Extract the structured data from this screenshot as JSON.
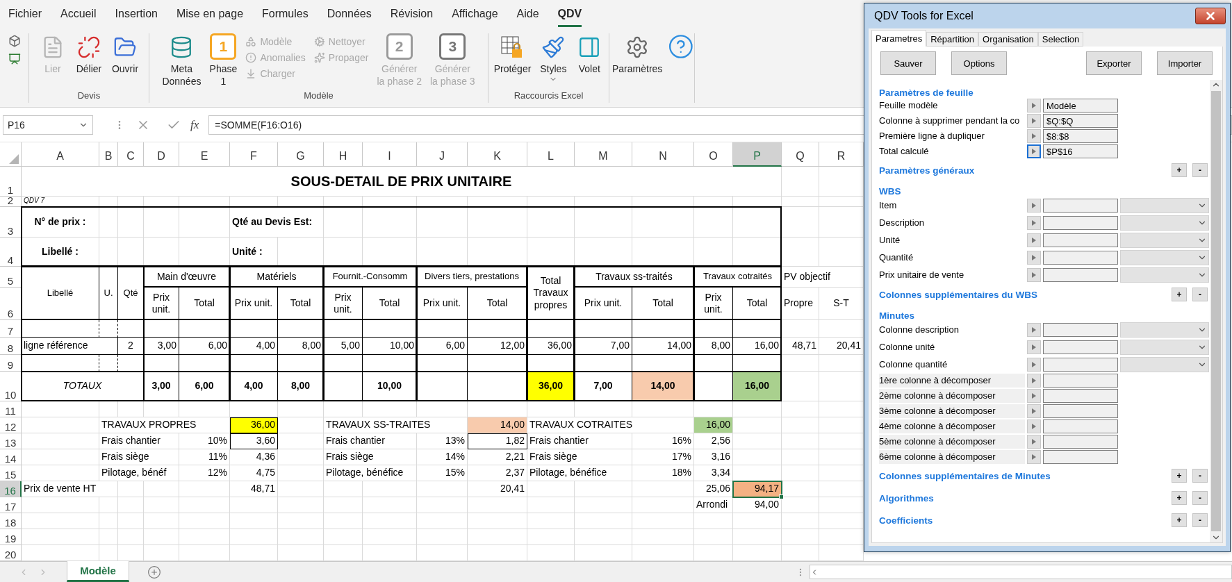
{
  "ribbon": {
    "tabs": [
      {
        "label": "Fichier",
        "selected": false
      },
      {
        "label": "Accueil",
        "selected": false
      },
      {
        "label": "Insertion",
        "selected": false
      },
      {
        "label": "Mise en page",
        "selected": false
      },
      {
        "label": "Formules",
        "selected": false
      },
      {
        "label": "Données",
        "selected": false
      },
      {
        "label": "Révision",
        "selected": false
      },
      {
        "label": "Affichage",
        "selected": false
      },
      {
        "label": "Aide",
        "selected": false
      },
      {
        "label": "QDV",
        "selected": true
      }
    ],
    "groups": [
      {
        "items": [
          {
            "kind": "mini"
          },
          {
            "kind": "mini"
          }
        ]
      },
      {
        "label": "Devis",
        "items": [
          {
            "kind": "large",
            "lines": [
              "Lier"
            ],
            "disabled": true
          },
          {
            "kind": "large",
            "lines": [
              "Délier"
            ],
            "disabled": false
          },
          {
            "kind": "large",
            "lines": [
              "Ouvrir"
            ],
            "disabled": false
          }
        ]
      },
      {
        "label": "Modèle",
        "items": [
          {
            "kind": "large",
            "lines": [
              "Meta",
              "Données"
            ],
            "disabled": false
          },
          {
            "kind": "badge",
            "badge": "1",
            "lines": [
              "Phase",
              "1"
            ],
            "disabled": false
          },
          {
            "kind": "stack",
            "entries": [
              {
                "label": "Modèle",
                "disabled": true
              },
              {
                "label": "Anomalies",
                "disabled": true
              },
              {
                "label": "Charger",
                "disabled": true
              }
            ]
          },
          {
            "kind": "stack",
            "entries": [
              {
                "label": "Nettoyer",
                "disabled": true
              },
              {
                "label": "Propager",
                "disabled": true
              }
            ]
          },
          {
            "kind": "badge",
            "badge": "2",
            "lines": [
              "Générer",
              "la phase 2"
            ],
            "disabled": true
          },
          {
            "kind": "badge",
            "badge": "3",
            "lines": [
              "Générer",
              "la phase 3"
            ],
            "disabled": true
          }
        ]
      },
      {
        "label": "Raccourcis Excel",
        "items": [
          {
            "kind": "large",
            "lines": [
              "Protéger"
            ],
            "disabled": false
          },
          {
            "kind": "menu",
            "lines": [
              "Styles"
            ],
            "disabled": false
          },
          {
            "kind": "large",
            "lines": [
              "Volet"
            ],
            "disabled": false
          }
        ]
      },
      {
        "items": [
          {
            "kind": "large",
            "lines": [
              "Paramètres"
            ],
            "disabled": false
          },
          {
            "kind": "mini"
          }
        ]
      }
    ]
  },
  "sheet": {
    "name_box": "P16",
    "function_label": "fx",
    "formula": "=SOMME(F16:O16)",
    "columns": [
      {
        "label": "A",
        "selected": false
      },
      {
        "label": "B",
        "selected": false
      },
      {
        "label": "C",
        "selected": false
      },
      {
        "label": "D",
        "selected": false
      },
      {
        "label": "E",
        "selected": false
      },
      {
        "label": "F",
        "selected": false
      },
      {
        "label": "G",
        "selected": false
      },
      {
        "label": "H",
        "selected": false
      },
      {
        "label": "I",
        "selected": false
      },
      {
        "label": "J",
        "selected": false
      },
      {
        "label": "K",
        "selected": false
      },
      {
        "label": "L",
        "selected": false
      },
      {
        "label": "M",
        "selected": false
      },
      {
        "label": "N",
        "selected": false
      },
      {
        "label": "O",
        "selected": false
      },
      {
        "label": "P",
        "selected": true
      },
      {
        "label": "Q",
        "selected": false
      },
      {
        "label": "R",
        "selected": false
      }
    ],
    "rows": [
      {
        "number": "1",
        "selected": false,
        "cells": [
          {
            "text": "SOUS-DETAIL DE PRIX UNITAIRE"
          }
        ]
      },
      {
        "number": "2",
        "selected": false,
        "cells": [
          {
            "text": "QDV 7"
          }
        ]
      },
      {
        "number": "3",
        "selected": false,
        "cells": [
          {
            "text": "N° de prix :"
          },
          {
            "text": "Qté au Devis Est:"
          }
        ]
      },
      {
        "number": "4",
        "selected": false,
        "cells": [
          {
            "text": "Libellé :"
          },
          {
            "text": "Unité :"
          }
        ]
      },
      {
        "number": "5",
        "selected": false,
        "cells": [
          {
            "text": "Libellé"
          },
          {
            "text": "U."
          },
          {
            "text": "Qté"
          },
          {
            "text": "Main d'œuvre"
          },
          {
            "text": "Matériels"
          },
          {
            "text": "Fournit.-Consomm"
          },
          {
            "text": "Divers tiers, prestations"
          },
          {
            "text": "Total Travaux propres"
          },
          {
            "text": "Travaux ss-traités"
          },
          {
            "text": "Travaux cotraités"
          },
          {
            "text": "PV objectif"
          }
        ]
      },
      {
        "number": "6",
        "selected": false,
        "cells": [
          {
            "text": "Prix unit."
          },
          {
            "text": "Total"
          },
          {
            "text": "Prix unit."
          },
          {
            "text": "Total"
          },
          {
            "text": "Prix unit."
          },
          {
            "text": "Total"
          },
          {
            "text": "Prix unit."
          },
          {
            "text": "Total"
          },
          {
            "text": "Prix unit."
          },
          {
            "text": "Total"
          },
          {
            "text": "Prix unit."
          },
          {
            "text": "Total"
          },
          {
            "text": "Propre"
          },
          {
            "text": "S-T"
          }
        ]
      },
      {
        "number": "7",
        "selected": false
      },
      {
        "number": "8",
        "selected": false,
        "cells": [
          {
            "text": "ligne référence"
          },
          {
            "text": "2"
          },
          {
            "text": "3,00"
          },
          {
            "text": "6,00"
          },
          {
            "text": "4,00"
          },
          {
            "text": "8,00"
          },
          {
            "text": "5,00"
          },
          {
            "text": "10,00"
          },
          {
            "text": "6,00"
          },
          {
            "text": "12,00"
          },
          {
            "text": "36,00"
          },
          {
            "text": "7,00"
          },
          {
            "text": "14,00"
          },
          {
            "text": "8,00"
          },
          {
            "text": "16,00"
          },
          {
            "text": "48,71"
          },
          {
            "text": "20,41"
          }
        ]
      },
      {
        "number": "9",
        "selected": false
      },
      {
        "number": "10",
        "selected": false,
        "cells": [
          {
            "text": "TOTAUX"
          },
          {
            "text": "3,00"
          },
          {
            "text": "6,00"
          },
          {
            "text": "4,00"
          },
          {
            "text": "8,00"
          },
          {
            "text": "10,00"
          },
          {
            "text": "36,00",
            "color": "#ffff00"
          },
          {
            "text": "7,00"
          },
          {
            "text": "14,00",
            "color": "#f8cbad"
          },
          {
            "text": "16,00",
            "color": "#a9d08e"
          }
        ]
      },
      {
        "number": "11",
        "selected": false
      },
      {
        "number": "12",
        "selected": false,
        "cells": [
          {
            "text": "TRAVAUX PROPRES"
          },
          {
            "text": "36,00",
            "color": "#ffff00"
          },
          {
            "text": "TRAVAUX SS-TRAITES"
          },
          {
            "text": "14,00",
            "color": "#f8cbad"
          },
          {
            "text": "TRAVAUX COTRAITES"
          },
          {
            "text": "16,00",
            "color": "#a9d08e"
          }
        ]
      },
      {
        "number": "13",
        "selected": false,
        "cells": [
          {
            "text": "Frais chantier"
          },
          {
            "text": "10%"
          },
          {
            "text": "3,60"
          },
          {
            "text": "Frais chantier"
          },
          {
            "text": "13%"
          },
          {
            "text": "1,82"
          },
          {
            "text": "Frais chantier"
          },
          {
            "text": "16%"
          },
          {
            "text": "2,56"
          }
        ]
      },
      {
        "number": "14",
        "selected": false,
        "cells": [
          {
            "text": "Frais siège"
          },
          {
            "text": "11%"
          },
          {
            "text": "4,36"
          },
          {
            "text": "Frais siège"
          },
          {
            "text": "14%"
          },
          {
            "text": "2,21"
          },
          {
            "text": "Frais siège"
          },
          {
            "text": "17%"
          },
          {
            "text": "3,16"
          }
        ]
      },
      {
        "number": "15",
        "selected": false,
        "cells": [
          {
            "text": "Pilotage, bénéf"
          },
          {
            "text": "12%"
          },
          {
            "text": "4,75"
          },
          {
            "text": "Pilotage, bénéfice"
          },
          {
            "text": "15%"
          },
          {
            "text": "2,37"
          },
          {
            "text": "Pilotage, bénéfice"
          },
          {
            "text": "18%"
          },
          {
            "text": "3,34"
          }
        ]
      },
      {
        "number": "16",
        "selected": true,
        "cells": [
          {
            "text": "Prix de vente HT"
          },
          {
            "text": "48,71"
          },
          {
            "text": "20,41"
          },
          {
            "text": "25,06"
          },
          {
            "text": "94,17",
            "color": "#f4b183"
          }
        ]
      },
      {
        "number": "17",
        "selected": false,
        "cells": [
          {
            "text": "Arrondi"
          },
          {
            "text": "94,00"
          }
        ]
      },
      {
        "number": "18",
        "selected": false
      },
      {
        "number": "19",
        "selected": false
      },
      {
        "number": "20",
        "selected": false
      }
    ]
  },
  "sheet_tabs": [
    {
      "label": "Modèle",
      "selected": true
    }
  ],
  "panel": {
    "title": "QDV Tools for Excel",
    "tabs": [
      {
        "label": "Parametres",
        "selected": true
      },
      {
        "label": "Répartition",
        "selected": false
      },
      {
        "label": "Organisation",
        "selected": false
      },
      {
        "label": "Selection",
        "selected": false
      }
    ],
    "buttons": [
      "Sauver",
      "Options",
      "Exporter",
      "Importer"
    ],
    "sections": [
      {
        "title": "Paramètres de feuille",
        "rows": [
          {
            "kind": "field",
            "label": "Feuille modèle",
            "value": "Modèle",
            "focused": false
          },
          {
            "kind": "field",
            "label": "Colonne à supprimer pendant la co",
            "value": "$Q:$Q",
            "focused": false
          },
          {
            "kind": "field",
            "label": "Première ligne à dupliquer",
            "value": "$8:$8",
            "focused": false
          },
          {
            "kind": "field",
            "label": "Total calculé",
            "value": "$P$16",
            "focused": true
          }
        ]
      },
      {
        "title": "Paramètres généraux",
        "buttons": [
          "+",
          "-"
        ]
      },
      {
        "title": "WBS",
        "rows": [
          {
            "kind": "dropdown",
            "label": "Item"
          },
          {
            "kind": "dropdown",
            "label": "Description"
          },
          {
            "kind": "dropdown",
            "label": "Unité"
          },
          {
            "kind": "dropdown",
            "label": "Quantité"
          },
          {
            "kind": "dropdown",
            "label": "Prix unitaire de vente"
          }
        ]
      },
      {
        "title": "Colonnes supplémentaires du WBS",
        "buttons": [
          "+",
          "-"
        ]
      },
      {
        "title": "Minutes",
        "rows": [
          {
            "kind": "dropdown",
            "label": "Colonne description"
          },
          {
            "kind": "dropdown",
            "label": "Colonne unité"
          },
          {
            "kind": "dropdown",
            "label": "Colonne quantité"
          },
          {
            "kind": "shaded",
            "label": "1ère colonne à décomposer"
          },
          {
            "kind": "shaded",
            "label": "2ème colonne à décomposer"
          },
          {
            "kind": "shaded",
            "label": "3ème colonne à décomposer"
          },
          {
            "kind": "shaded",
            "label": "4ème colonne à décomposer"
          },
          {
            "kind": "shaded",
            "label": "5ème colonne à décomposer"
          },
          {
            "kind": "shaded",
            "label": "6ème colonne à décomposer"
          }
        ]
      },
      {
        "title": "Colonnes supplémentaires de Minutes",
        "buttons": [
          "+",
          "-"
        ]
      },
      {
        "title": "Algorithmes",
        "buttons": [
          "+",
          "-"
        ]
      },
      {
        "title": "Coefficients",
        "buttons": [
          "+",
          "-"
        ]
      }
    ]
  }
}
